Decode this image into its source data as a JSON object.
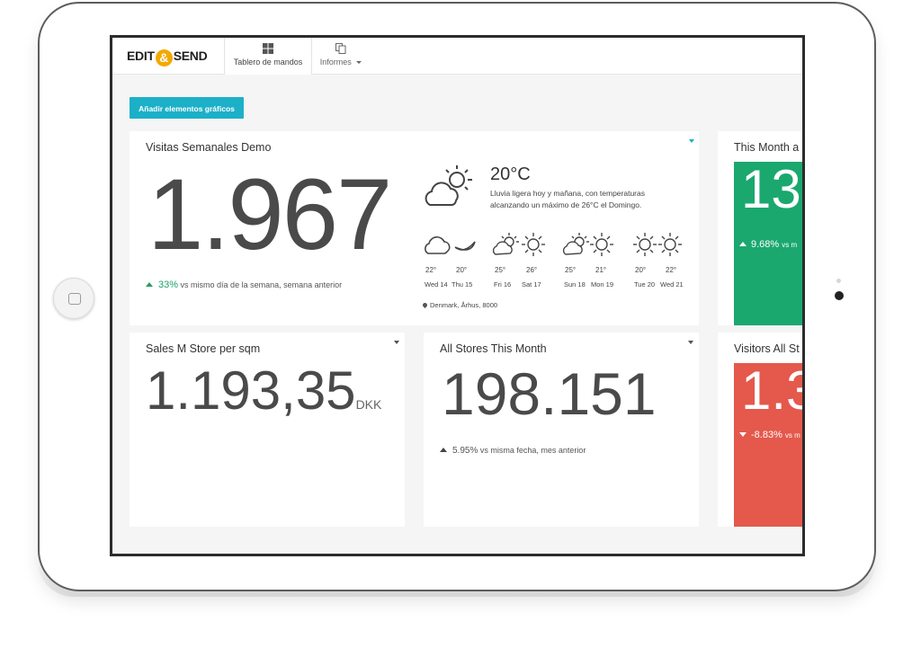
{
  "navbar": {
    "logo_left": "EDIT",
    "logo_amp": "&",
    "logo_right": "SEND",
    "tabs": [
      {
        "label": "Tablero de mandos",
        "icon": "windows-icon",
        "active": true
      },
      {
        "label": "Informes",
        "icon": "copy-icon",
        "has_dropdown": true
      }
    ]
  },
  "toolbar": {
    "add_button": "Añadir elementos gráficos"
  },
  "widgets": {
    "visitas": {
      "title": "Visitas Semanales Demo",
      "value": "1.967",
      "delta_pct": "33%",
      "delta_text": "vs mismo día de la semana, semana anterior"
    },
    "weather": {
      "temp": "20°C",
      "description": "Lluvia ligera hoy y mañana, con temperaturas alcanzando un máximo de 26°C el Domingo.",
      "forecast": [
        {
          "day": "Wed 14",
          "temp": "22°",
          "icon": "cloud-icon"
        },
        {
          "day": "Thu 15",
          "temp": "20°",
          "icon": "crescent-icon"
        },
        {
          "day": "Fri 16",
          "temp": "25°",
          "icon": "partly-cloudy-icon"
        },
        {
          "day": "Sat 17",
          "temp": "26°",
          "icon": "sun-icon"
        },
        {
          "day": "Sun 18",
          "temp": "25°",
          "icon": "partly-cloudy-icon"
        },
        {
          "day": "Mon 19",
          "temp": "21°",
          "icon": "sun-icon"
        },
        {
          "day": "Tue 20",
          "temp": "20°",
          "icon": "sun-icon"
        },
        {
          "day": "Wed 21",
          "temp": "22°",
          "icon": "sun-icon"
        }
      ],
      "location": "Denmark, Århus, 8000"
    },
    "this_month": {
      "title": "This Month a",
      "value": "13",
      "delta_pct": "9.68%",
      "delta_text": "vs m",
      "color": "#1aa86f"
    },
    "sales": {
      "title": "Sales M Store per sqm",
      "value": "1.193,35",
      "unit": "DKK"
    },
    "all_stores": {
      "title": "All Stores This Month",
      "value": "198.151",
      "delta_pct": "5.95%",
      "delta_text": "vs misma fecha, mes anterior"
    },
    "visitors": {
      "title": "Visitors All St",
      "value": "1.3",
      "delta_pct": "-8.83%",
      "delta_text": "vs m",
      "color": "#e5584c"
    }
  },
  "colors": {
    "accent": "#1cb0c8",
    "positive": "#1aa368",
    "logo_amp": "#f2a900"
  }
}
